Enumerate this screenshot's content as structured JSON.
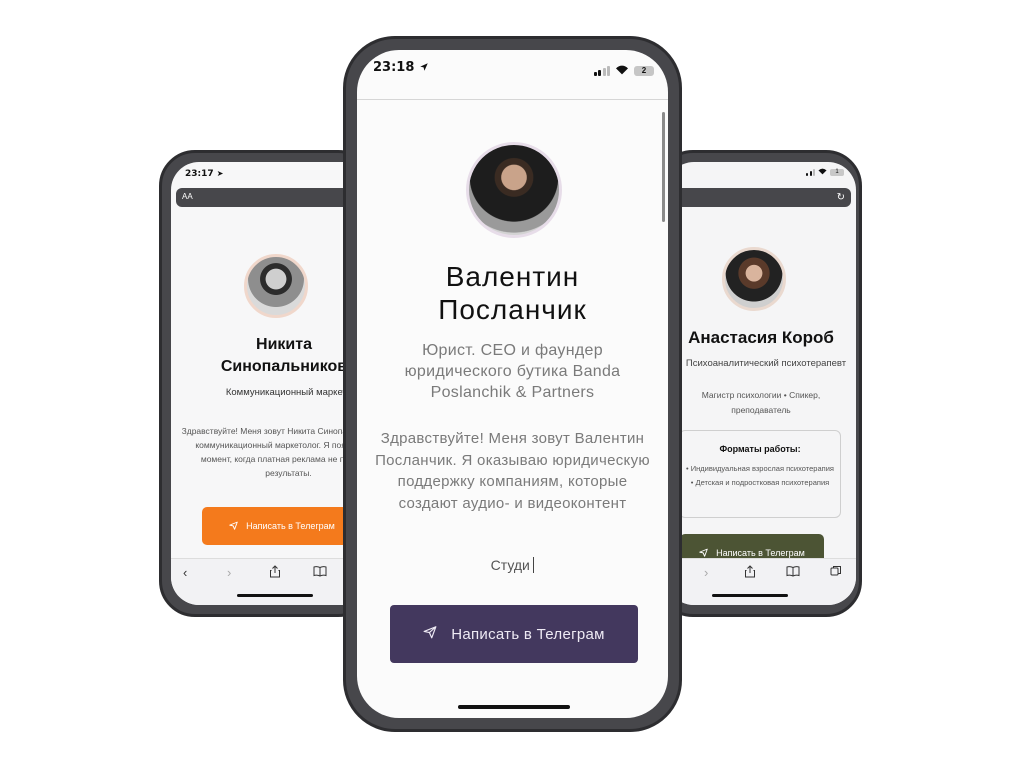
{
  "left_phone": {
    "status_time": "23:17",
    "address_label": "AA",
    "name_line1": "Никита",
    "name_line2": "Синопальников",
    "role": "Коммуникационный маркетолог",
    "bio": "Здравствуйте! Меня зовут Никита Синопальников, и я коммуникационный маркетолог. Я появляюсь в момент, когда платная реклама не приносит результаты.",
    "button_label": "Написать в Телеграм",
    "button_color": "#f47a1c"
  },
  "center_phone": {
    "status_time": "23:18",
    "battery_label": "2",
    "name_line1": "Валентин",
    "name_line2": "Посланчик",
    "role": "Юрист. CEO и фаундер юридического бутика Banda Poslanchik & Partners",
    "bio": "Здравствуйте! Меня зовут Валентин Посланчик. Я оказываю юридическую поддержку компаниям, которые создают аудио- и видеоконтент",
    "typing_text": "Студи",
    "button_label": "Написать в Телеграм",
    "button_color": "#43385e"
  },
  "right_phone": {
    "battery_label": "1",
    "name": "Анастасия Короб",
    "role": "Психоаналитический психотерапевт",
    "quals_line1": "Магистр психологии • Спикер,",
    "quals_line2": "преподаватель",
    "formats_title": "Форматы работы:",
    "format_item1": "• Индивидуальная взрослая психотерапия",
    "format_item2": "• Детская и подростковая психотерапия",
    "button_label": "Написать в Телеграм",
    "button_color": "#4c5434"
  },
  "icons": {
    "send": "➤",
    "back": "‹",
    "forward": "›",
    "share": "⇧",
    "bookmarks": "📖",
    "tabs": "⧉",
    "reload": "↻"
  }
}
